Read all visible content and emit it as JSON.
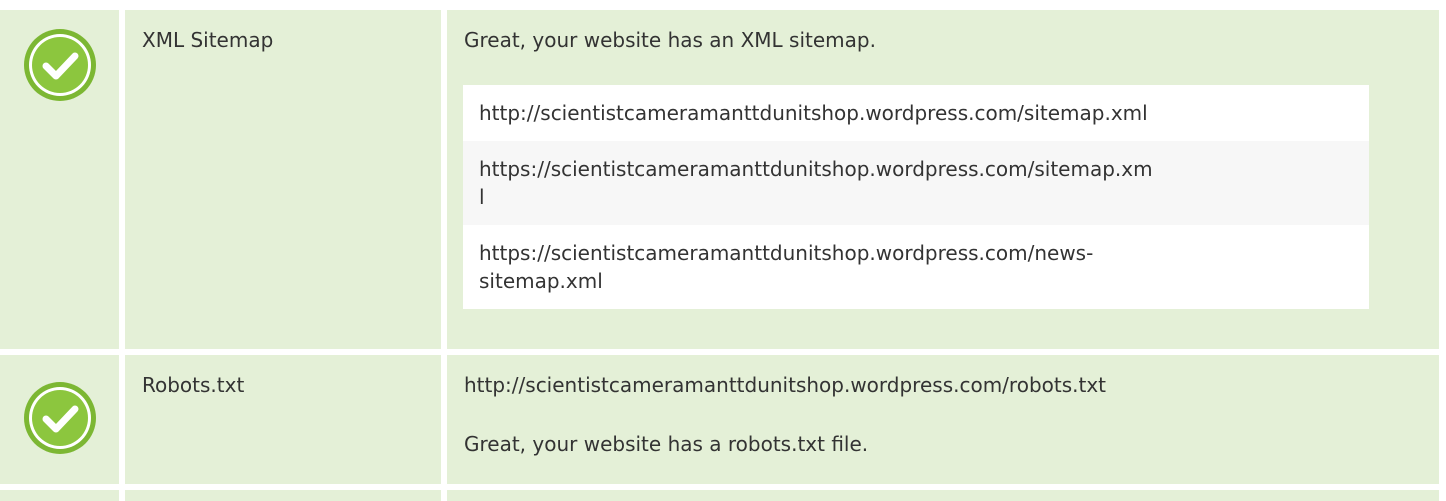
{
  "rows": [
    {
      "status_icon": "check-circle-icon",
      "label": "XML Sitemap",
      "message": "Great, your website has an XML sitemap.",
      "sitemaps": [
        "http://scientistcameramanttdunitshop.wordpress.com/sitemap.xml",
        "https://scientistcameramanttdunitshop.wordpress.com/sitemap.xm\nl",
        "https://scientistcameramanttdunitshop.wordpress.com/news-\nsitemap.xml"
      ]
    },
    {
      "status_icon": "check-circle-icon",
      "label": "Robots.txt",
      "url": "http://scientistcameramanttdunitshop.wordpress.com/robots.txt",
      "message": "Great, your website has a robots.txt file."
    }
  ],
  "colors": {
    "row_bg": "#e4f0d7",
    "check_green": "#8cc63e",
    "text": "#333333"
  }
}
